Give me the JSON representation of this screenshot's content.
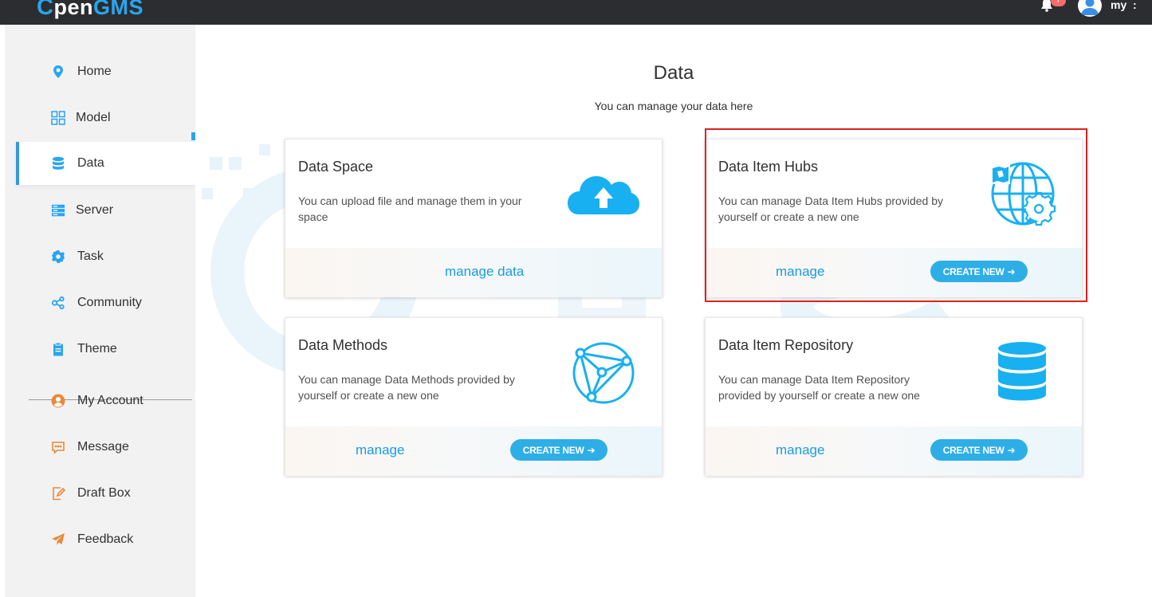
{
  "topbar": {
    "logo_o": "C",
    "logo_pen": "pen",
    "logo_gms": "GMS",
    "notification_count": "7",
    "user_name": "my",
    "more_label": ":"
  },
  "sidebar": {
    "items": [
      {
        "label": "Home",
        "icon": "location-pin-icon"
      },
      {
        "label": "Model",
        "icon": "grid-icon"
      },
      {
        "label": "Data",
        "icon": "database-icon"
      },
      {
        "label": "Server",
        "icon": "server-icon"
      },
      {
        "label": "Task",
        "icon": "gear-icon"
      },
      {
        "label": "Community",
        "icon": "share-nodes-icon"
      },
      {
        "label": "Theme",
        "icon": "clipboard-icon"
      },
      {
        "label": "My Account",
        "icon": "user-circle-icon"
      },
      {
        "label": "Message",
        "icon": "chat-bubble-icon"
      },
      {
        "label": "Draft Box",
        "icon": "edit-note-icon"
      },
      {
        "label": "Feedback",
        "icon": "paper-plane-icon"
      }
    ],
    "active": "Data"
  },
  "main": {
    "title": "Data",
    "subtitle": "You can manage your data here",
    "cards": [
      {
        "title": "Data Space",
        "desc": "You can upload file and manage them in your space",
        "link": "manage data",
        "button": "",
        "icon": "cloud-upload-icon"
      },
      {
        "title": "Data Item Hubs",
        "desc": "You can manage Data Item Hubs provided by yourself or create a new one",
        "link": "manage",
        "button": "CREATE NEW",
        "icon": "globe-gear-icon"
      },
      {
        "title": "Data Methods",
        "desc": "You can manage Data Methods provided by yourself or create a new one",
        "link": "manage",
        "button": "CREATE NEW",
        "icon": "network-triangle-icon"
      },
      {
        "title": "Data Item Repository",
        "desc": "You can manage Data Item Repository provided by yourself or create a new one",
        "link": "manage",
        "button": "CREATE NEW",
        "icon": "database-stack-icon"
      }
    ]
  },
  "colors": {
    "accent": "#29a5f0",
    "button": "#2eaee6",
    "link": "#1a9be0",
    "topbar": "#2c2d30",
    "highlight": "#e02020"
  }
}
